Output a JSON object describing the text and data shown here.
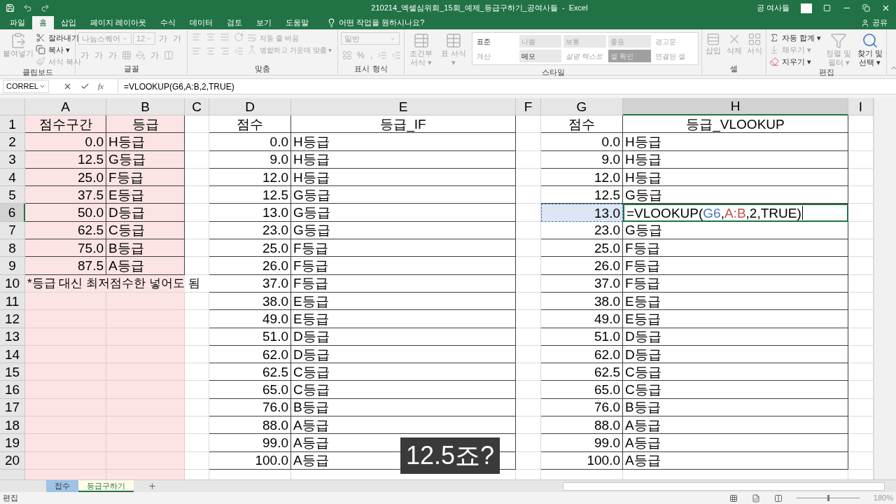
{
  "title_bar": {
    "title": "210214_엑셀심위회_15회_예제_등급구하기_공여사들  -  Excel",
    "user": "공 여사들"
  },
  "menu_tabs": [
    {
      "label": "파일",
      "selected": false
    },
    {
      "label": "홈",
      "selected": true
    },
    {
      "label": "삽입",
      "selected": false
    },
    {
      "label": "페이지 레이아웃",
      "selected": false
    },
    {
      "label": "수식",
      "selected": false
    },
    {
      "label": "데이터",
      "selected": false
    },
    {
      "label": "검토",
      "selected": false
    },
    {
      "label": "보기",
      "selected": false
    },
    {
      "label": "도움말",
      "selected": false
    }
  ],
  "tell_me": "어떤 작업을 원하시나요?",
  "share": "공유",
  "ribbon": [
    {
      "label": "클립보드",
      "items": [
        {
          "kind": "large",
          "label": "붙여넣기",
          "disabled": true
        },
        {
          "kind": "small",
          "label": "잘라내기",
          "disabled": false
        },
        {
          "kind": "small",
          "label": "복사 ▾",
          "disabled": false
        },
        {
          "kind": "small",
          "label": "서식 복사",
          "disabled": true
        }
      ]
    },
    {
      "label": "글꼴",
      "items": [
        {
          "kind": "field",
          "label": "나눔스퀘어",
          "disabled": true
        },
        {
          "kind": "field",
          "label": "12",
          "disabled": true
        },
        {
          "kind": "glyph",
          "label": "가",
          "disabled": true
        },
        {
          "kind": "glyph",
          "label": "가",
          "disabled": true
        },
        {
          "kind": "glyph",
          "label": "가",
          "disabled": true
        },
        {
          "kind": "glyph",
          "label": "가",
          "disabled": true
        },
        {
          "kind": "glyph",
          "label": "가",
          "disabled": true
        },
        {
          "kind": "icon",
          "disabled": true
        },
        {
          "kind": "icon",
          "disabled": true
        },
        {
          "kind": "glyph",
          "label": "가",
          "disabled": true
        },
        {
          "kind": "icon",
          "disabled": true
        }
      ]
    },
    {
      "label": "맞춤",
      "items": [
        {
          "kind": "icon",
          "disabled": true
        },
        {
          "kind": "icon",
          "disabled": true
        },
        {
          "kind": "icon",
          "disabled": true
        },
        {
          "kind": "icon",
          "disabled": true
        },
        {
          "kind": "icon",
          "disabled": true
        },
        {
          "kind": "icon",
          "disabled": true
        },
        {
          "kind": "icon",
          "disabled": true
        },
        {
          "kind": "icon",
          "disabled": true
        },
        {
          "kind": "small",
          "label": "자동 줄 바꿈",
          "disabled": true
        },
        {
          "kind": "small",
          "label": "병합하고 가운데 맞춤 ▾",
          "disabled": true
        }
      ]
    },
    {
      "label": "표시 형식",
      "items": [
        {
          "kind": "field",
          "label": "일반",
          "disabled": true
        },
        {
          "kind": "icon",
          "disabled": true
        },
        {
          "kind": "glyph",
          "label": "%",
          "disabled": true
        },
        {
          "kind": "glyph",
          "label": ",",
          "disabled": true
        },
        {
          "kind": "icon",
          "disabled": true
        },
        {
          "kind": "icon",
          "disabled": true
        }
      ]
    },
    {
      "label": "스타일",
      "items": [
        {
          "kind": "large",
          "label": "조건부 서식 ▾",
          "disabled": true
        },
        {
          "kind": "large",
          "label": "표 서식 ▾",
          "disabled": true
        }
      ],
      "styles": [
        {
          "label": "표준",
          "disabled": false
        },
        {
          "label": "나쁨",
          "disabled": true
        },
        {
          "label": "보통",
          "disabled": true
        },
        {
          "label": "좋음",
          "disabled": true
        },
        {
          "label": "경고문",
          "disabled": true
        },
        {
          "label": "계산",
          "disabled": true
        },
        {
          "label": "메모",
          "disabled": false
        },
        {
          "label": "설명 텍스트",
          "disabled": true
        },
        {
          "label": "셀 확인",
          "disabled": true
        },
        {
          "label": "연결된 셀",
          "disabled": true
        }
      ]
    },
    {
      "label": "셀",
      "items": [
        {
          "kind": "large",
          "label": "삽입",
          "disabled": true
        },
        {
          "kind": "large",
          "label": "삭제",
          "disabled": true
        },
        {
          "kind": "large",
          "label": "서식",
          "disabled": true
        }
      ]
    },
    {
      "label": "편집",
      "items": [
        {
          "kind": "small",
          "label": "자동 합계 ▾",
          "disabled": false
        },
        {
          "kind": "small",
          "label": "채우기 ▾",
          "disabled": true
        },
        {
          "kind": "small",
          "label": "지우기 ▾",
          "disabled": false
        },
        {
          "kind": "large",
          "label": "정렬 및 필터 ▾",
          "disabled": true
        },
        {
          "kind": "large",
          "label": "찾기 및 선택 ▾",
          "disabled": false
        }
      ]
    }
  ],
  "formula_bar": {
    "name_box": "CORREL",
    "fx": "fx",
    "formula": "=VLOOKUP(G6,A:B,2,TRUE)"
  },
  "columns": [
    {
      "label": "A",
      "shaded": true,
      "selected": false
    },
    {
      "label": "B",
      "shaded": true,
      "selected": false
    },
    {
      "label": "C",
      "shaded": false,
      "selected": false
    },
    {
      "label": "D",
      "shaded": false,
      "selected": false
    },
    {
      "label": "E",
      "shaded": false,
      "selected": false
    },
    {
      "label": "F",
      "shaded": false,
      "selected": false
    },
    {
      "label": "G",
      "shaded": false,
      "selected": false
    },
    {
      "label": "H",
      "shaded": false,
      "selected": true
    },
    {
      "label": "I",
      "shaded": false,
      "selected": false
    }
  ],
  "rows": [
    {
      "number": "1",
      "selected": false,
      "kind": "header",
      "cells": {
        "A": "점수구간",
        "B": "등급",
        "D": "점수",
        "E": "등급_IF",
        "G": "점수",
        "H": "등급_VLOOKUP"
      }
    },
    {
      "number": "2",
      "selected": false,
      "cells": {
        "A": "0.0",
        "B": "H등급",
        "D": "0.0",
        "E": "H등급",
        "G": "0.0",
        "H": "H등급"
      }
    },
    {
      "number": "3",
      "selected": false,
      "cells": {
        "A": "12.5",
        "B": "G등급",
        "D": "9.0",
        "E": "H등급",
        "G": "9.0",
        "H": "H등급"
      }
    },
    {
      "number": "4",
      "selected": false,
      "cells": {
        "A": "25.0",
        "B": "F등급",
        "D": "12.0",
        "E": "H등급",
        "G": "12.0",
        "H": "H등급"
      }
    },
    {
      "number": "5",
      "selected": false,
      "cells": {
        "A": "37.5",
        "B": "E등급",
        "D": "12.5",
        "E": "G등급",
        "G": "12.5",
        "H": "G등급"
      }
    },
    {
      "number": "6",
      "selected": true,
      "cells": {
        "A": "50.0",
        "B": "D등급",
        "D": "13.0",
        "E": "G등급",
        "G": {
          "text": "13.0",
          "highlighted": true
        },
        "H": {
          "editing": true,
          "parts": [
            {
              "text": "=VLOOKUP("
            },
            {
              "text": "G6",
              "color": "#4a72c0"
            },
            {
              "text": ","
            },
            {
              "text": "A:B",
              "color": "#c0504d"
            },
            {
              "text": ",2,TRUE)"
            }
          ]
        }
      }
    },
    {
      "number": "7",
      "selected": false,
      "cells": {
        "A": "62.5",
        "B": "C등급",
        "D": "23.0",
        "E": "G등급",
        "G": "23.0",
        "H": "G등급"
      }
    },
    {
      "number": "8",
      "selected": false,
      "cells": {
        "A": "75.0",
        "B": "B등급",
        "D": "25.0",
        "E": "F등급",
        "G": "25.0",
        "H": "F등급"
      }
    },
    {
      "number": "9",
      "selected": false,
      "cells": {
        "A": "87.5",
        "B": "A등급",
        "D": "26.0",
        "E": "F등급",
        "G": "26.0",
        "H": "F등급"
      }
    },
    {
      "number": "10",
      "selected": false,
      "note": "*등급 대신 최저점수한 넣어도 됨",
      "cells": {
        "D": "37.0",
        "E": "F등급",
        "G": "37.0",
        "H": "F등급"
      }
    },
    {
      "number": "11",
      "selected": false,
      "cells": {
        "D": "38.0",
        "E": "E등급",
        "G": "38.0",
        "H": "E등급"
      }
    },
    {
      "number": "12",
      "selected": false,
      "cells": {
        "D": "49.0",
        "E": "E등급",
        "G": "49.0",
        "H": "E등급"
      }
    },
    {
      "number": "13",
      "selected": false,
      "cells": {
        "D": "51.0",
        "E": "D등급",
        "G": "51.0",
        "H": "D등급"
      }
    },
    {
      "number": "14",
      "selected": false,
      "cells": {
        "D": "62.0",
        "E": "D등급",
        "G": "62.0",
        "H": "D등급"
      }
    },
    {
      "number": "15",
      "selected": false,
      "cells": {
        "D": "62.5",
        "E": "C등급",
        "G": "62.5",
        "H": "C등급"
      }
    },
    {
      "number": "16",
      "selected": false,
      "cells": {
        "D": "65.0",
        "E": "C등급",
        "G": "65.0",
        "H": "C등급"
      }
    },
    {
      "number": "17",
      "selected": false,
      "cells": {
        "D": "76.0",
        "E": "B등급",
        "G": "76.0",
        "H": "B등급"
      }
    },
    {
      "number": "18",
      "selected": false,
      "cells": {
        "D": "88.0",
        "E": "A등급",
        "G": "88.0",
        "H": "A등급"
      }
    },
    {
      "number": "19",
      "selected": false,
      "cells": {
        "D": "99.0",
        "E": "A등급",
        "G": "99.0",
        "H": "A등급"
      }
    },
    {
      "number": "20",
      "selected": false,
      "cells": {
        "D": "100.0",
        "E": "A등급",
        "G": "100.0",
        "H": "A등급"
      }
    }
  ],
  "sheet_tabs": [
    {
      "label": "접수",
      "selected": false,
      "color": "#9dc3e6"
    },
    {
      "label": "등급구하기",
      "selected": true
    }
  ],
  "status_bar": {
    "mode": "편집",
    "zoom_slider": {
      "level": 0.5
    },
    "zoom": "180%"
  },
  "caption": "12.5죠?"
}
